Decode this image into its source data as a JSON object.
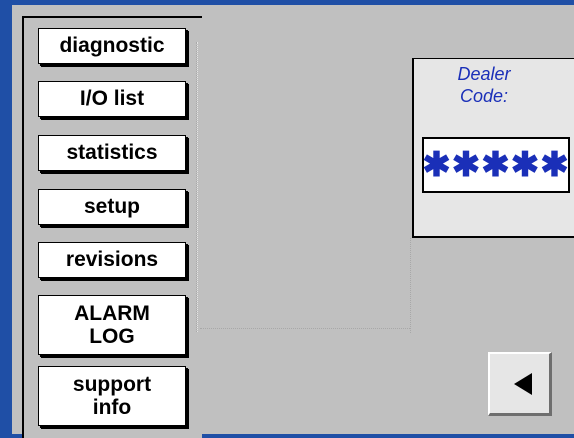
{
  "menu": {
    "items": [
      {
        "label": "diagnostic"
      },
      {
        "label": "I/O list"
      },
      {
        "label": "statistics"
      },
      {
        "label": "setup"
      },
      {
        "label": "revisions"
      },
      {
        "label": "ALARM\nLOG"
      },
      {
        "label": "support\ninfo"
      }
    ]
  },
  "dealer": {
    "label": "Dealer\nCode:",
    "code_value": "✱✱✱✱✱"
  },
  "nav": {
    "back_icon": "left-triangle-icon"
  },
  "colors": {
    "frame": "#1f4fa6",
    "background": "#c0c0c0",
    "accent_text": "#1a2fb8"
  }
}
